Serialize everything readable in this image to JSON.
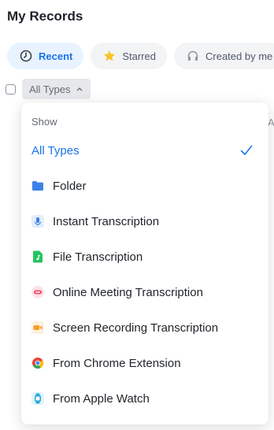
{
  "page": {
    "title": "My Records"
  },
  "tabs": [
    {
      "label": "Recent",
      "icon": "clock-icon",
      "active": true
    },
    {
      "label": "Starred",
      "icon": "star-icon",
      "active": false
    },
    {
      "label": "Created by me",
      "icon": "headphones-icon",
      "active": false
    }
  ],
  "filter": {
    "type_label": "All Types",
    "edge_text": "A"
  },
  "dropdown": {
    "header": "Show",
    "selected": "All Types",
    "items": [
      {
        "label": "All Types",
        "icon": ""
      },
      {
        "label": "Folder",
        "icon": "folder-icon"
      },
      {
        "label": "Instant Transcription",
        "icon": "microphone-icon"
      },
      {
        "label": "File Transcription",
        "icon": "audio-file-icon"
      },
      {
        "label": "Online Meeting Transcription",
        "icon": "meeting-icon"
      },
      {
        "label": "Screen Recording Transcription",
        "icon": "video-camera-icon"
      },
      {
        "label": "From Chrome Extension",
        "icon": "chrome-icon"
      },
      {
        "label": "From Apple Watch",
        "icon": "watch-icon"
      }
    ]
  },
  "colors": {
    "accent": "#1a73e8",
    "active_tab_bg": "#e8f3ff",
    "star": "#f7c325",
    "folder": "#3b82e6",
    "mic": "#3b82e6",
    "file": "#22c55e",
    "meeting": "#f04864",
    "video": "#f59e2b",
    "watch": "#26a6d9"
  }
}
